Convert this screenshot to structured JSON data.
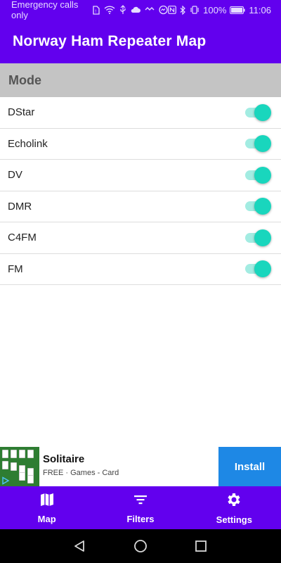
{
  "status_bar": {
    "carrier_text": "Emergency calls only",
    "battery_percent": "100%",
    "time": "11:06",
    "icons": [
      "sim-icon",
      "wifi-icon",
      "usb-icon",
      "cloud-icon",
      "loop-icon",
      "messenger-icon",
      "nfc-icon",
      "bluetooth-icon",
      "vibrate-icon",
      "battery-icon"
    ]
  },
  "app_bar": {
    "title": "Norway Ham Repeater Map"
  },
  "section": {
    "title": "Mode"
  },
  "modes": [
    {
      "label": "DStar",
      "enabled": true
    },
    {
      "label": "Echolink",
      "enabled": true
    },
    {
      "label": "DV",
      "enabled": true
    },
    {
      "label": "DMR",
      "enabled": true
    },
    {
      "label": "C4FM",
      "enabled": true
    },
    {
      "label": "FM",
      "enabled": true
    }
  ],
  "ad": {
    "title": "Solitaire",
    "subtitle": "FREE · Games - Card",
    "install_label": "Install",
    "icon": "solitaire-app-icon"
  },
  "bottom_nav": {
    "items": [
      {
        "label": "Map",
        "icon": "map-icon"
      },
      {
        "label": "Filters",
        "icon": "filter-icon"
      },
      {
        "label": "Settings",
        "icon": "gear-icon"
      }
    ]
  },
  "colors": {
    "primary": "#6200ee",
    "switch_thumb": "#19d6bd",
    "switch_track": "#a3ece2",
    "section_bg": "#c4c4c4",
    "install_button": "#1e88e5"
  }
}
